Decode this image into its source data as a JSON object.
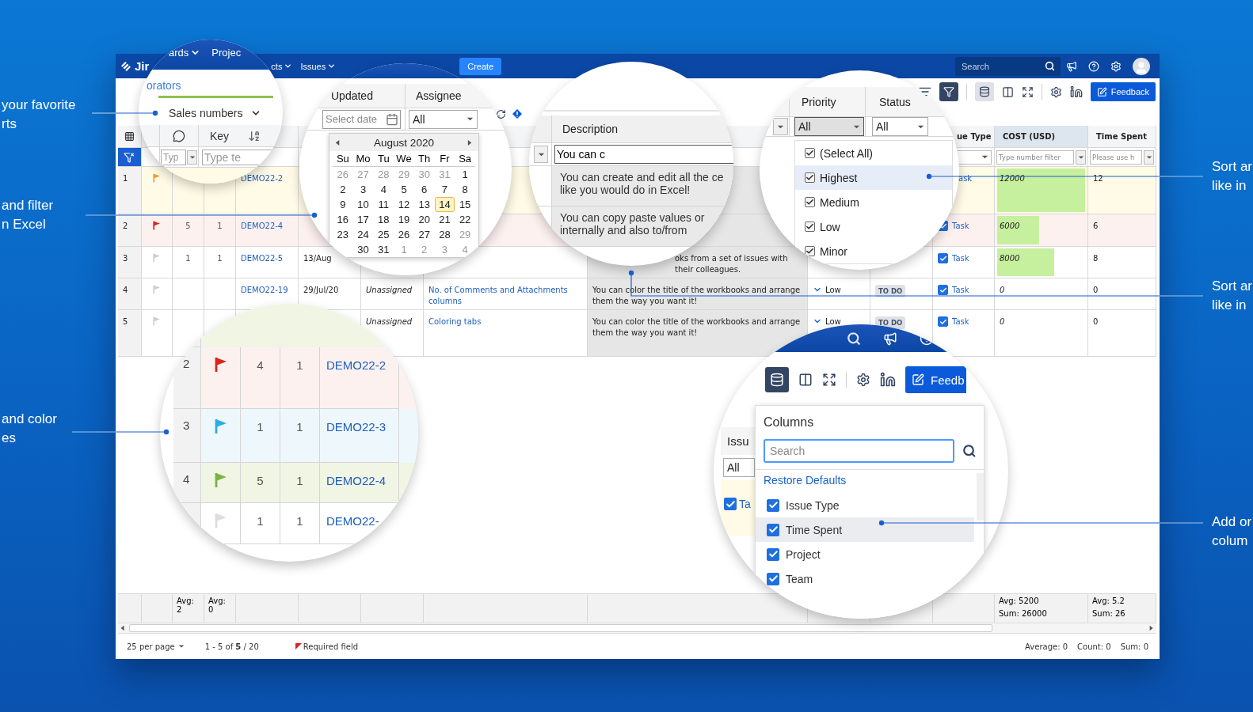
{
  "captions_left": [
    {
      "lines": [
        "your favorite",
        "rts"
      ]
    },
    {
      "lines": [
        "and filter",
        "n Excel"
      ]
    },
    {
      "lines": [
        "and color",
        "es"
      ]
    }
  ],
  "captions_right": [
    {
      "lines": [
        "Sort ar",
        "like in"
      ]
    },
    {
      "lines": [
        "Sort ar",
        "like in"
      ]
    },
    {
      "lines": [
        "Add or",
        "colum"
      ]
    }
  ],
  "navbar": {
    "logo": "Jir",
    "items": [
      "cts",
      "Issues"
    ],
    "create": "Create",
    "search": {
      "placeholder": "Search"
    }
  },
  "toolbar": {
    "filter_on": true,
    "columns_on": true,
    "feedback": "Feedback"
  },
  "header": {
    "issue_type": "ue Type",
    "cost": "COST (USD)",
    "time_spent": "Time Spent"
  },
  "filters": {
    "cost": {
      "placeholder": "Type number filter"
    },
    "time_spent": {
      "placeholder": "Please use h"
    }
  },
  "rows": [
    {
      "number": "1",
      "flag": {
        "color": "#f0a030"
      },
      "color": "#fffbe6",
      "key": "DEMO22-2",
      "issue_type": {
        "label": "ask",
        "cut": true
      },
      "cost": {
        "value": "12000",
        "level": 1
      },
      "time_spent": "12"
    },
    {
      "number": "2",
      "flag": {
        "color": "#d9261c"
      },
      "color": "#fdf1f0",
      "comments": "5",
      "attachments": "1",
      "key": "DEMO22-4",
      "issue_type": {
        "label": "Task",
        "checked": true
      },
      "cost": {
        "value": "6000",
        "level": 0.5
      },
      "time_spent": "6"
    },
    {
      "number": "3",
      "flag": {
        "color": "#cfcfcf"
      },
      "color": "#ffffff",
      "comments": "1",
      "attachments": "1",
      "key": "DEMO22-5",
      "updated": "13/Aug",
      "description": "oks from a set of issues with their colleagues.",
      "description_cut": true,
      "issue_type": {
        "label": "Task",
        "checked": true
      },
      "cost": {
        "value": "8000",
        "level": 0.67
      },
      "time_spent": "8"
    },
    {
      "number": "4",
      "flag": {
        "color": "#cfcfcf"
      },
      "color": "#ffffff",
      "key": "DEMO22-19",
      "updated": "29/Jul/20",
      "assignee": "Unassigned",
      "summary": "No. of Comments and Attachments columns",
      "description": "You can color the title of the workbooks and arrange them the way you want it!",
      "priority": "Low",
      "status": "TO DO",
      "issue_type": {
        "label": "Task",
        "checked": true
      },
      "cost": {
        "value": "0"
      },
      "time_spent": "0"
    },
    {
      "number": "5",
      "flag": {
        "color": "#cfcfcf"
      },
      "color": "#ffffff",
      "assignee": "Unassigned",
      "summary": "Coloring tabs",
      "description": "You can color the title of the workbooks and arrange them the way you want it!",
      "priority": "Low",
      "status": "TO DO",
      "issue_type": {
        "label": "Task",
        "checked": true
      },
      "cost": {
        "value": "0"
      },
      "time_spent": "0"
    }
  ],
  "aggregates": {
    "comments": [
      "Avg: 2"
    ],
    "attachments": [
      "Avg: 0"
    ],
    "cost": [
      "Avg: 5200",
      "Sum: 26000"
    ],
    "time_spent": [
      "Avg: 5.2",
      "Sum: 26"
    ]
  },
  "status_bar": {
    "per_page": "25 per page",
    "range": "1 - 5 of **5** / 20",
    "required": "Required field",
    "stats": [
      "Average: 0",
      "Count: 0",
      "Sum: 0"
    ]
  },
  "lens_tabs": {
    "nav": [
      "ards",
      "Projec"
    ],
    "tab": "orators",
    "workbook": "Sales numbers",
    "key_header": "Key",
    "filters": [
      {
        "placeholder": "Typ"
      },
      {
        "placeholder": "Type te"
      }
    ]
  },
  "lens_date": {
    "headers": [
      "Updated",
      "Assignee"
    ],
    "date_filter": {
      "placeholder": "Select date"
    },
    "assignee_filter": "All",
    "month": "August 2020",
    "weekdays": [
      "Su",
      "Mo",
      "Tu",
      "We",
      "Th",
      "Fr",
      "Sa"
    ],
    "weeks": [
      [
        {
          "d": "26",
          "muted": true,
          "selected": false
        },
        {
          "d": "27",
          "muted": true,
          "selected": false
        },
        {
          "d": "28",
          "muted": true,
          "selected": false
        },
        {
          "d": "29",
          "muted": true,
          "selected": false
        },
        {
          "d": "30",
          "muted": true,
          "selected": false
        },
        {
          "d": "31",
          "muted": true,
          "selected": false
        },
        {
          "d": "1",
          "muted": false,
          "selected": false
        }
      ],
      [
        {
          "d": "2",
          "muted": false,
          "selected": false
        },
        {
          "d": "3",
          "muted": false,
          "selected": false
        },
        {
          "d": "4",
          "muted": false,
          "selected": false
        },
        {
          "d": "5",
          "muted": false,
          "selected": false
        },
        {
          "d": "6",
          "muted": false,
          "selected": false
        },
        {
          "d": "7",
          "muted": false,
          "selected": false
        },
        {
          "d": "8",
          "muted": false,
          "selected": false
        }
      ],
      [
        {
          "d": "9",
          "muted": false,
          "selected": false
        },
        {
          "d": "10",
          "muted": false,
          "selected": false
        },
        {
          "d": "11",
          "muted": false,
          "selected": false
        },
        {
          "d": "12",
          "muted": false,
          "selected": false
        },
        {
          "d": "13",
          "muted": false,
          "selected": false
        },
        {
          "d": "14",
          "muted": false,
          "selected": true
        },
        {
          "d": "15",
          "muted": false,
          "selected": false
        }
      ],
      [
        {
          "d": "16",
          "muted": false,
          "selected": false
        },
        {
          "d": "17",
          "muted": false,
          "selected": false
        },
        {
          "d": "18",
          "muted": false,
          "selected": false
        },
        {
          "d": "19",
          "muted": false,
          "selected": false
        },
        {
          "d": "20",
          "muted": false,
          "selected": false
        },
        {
          "d": "21",
          "muted": false,
          "selected": false
        },
        {
          "d": "22",
          "muted": false,
          "selected": false
        }
      ],
      [
        {
          "d": "23",
          "muted": false,
          "selected": false
        },
        {
          "d": "24",
          "muted": false,
          "selected": false
        },
        {
          "d": "25",
          "muted": false,
          "selected": false
        },
        {
          "d": "26",
          "muted": false,
          "selected": false
        },
        {
          "d": "27",
          "muted": false,
          "selected": false
        },
        {
          "d": "28",
          "muted": false,
          "selected": false
        },
        {
          "d": "29",
          "muted": true,
          "selected": false
        }
      ],
      [
        {
          "d": "30",
          "muted": false,
          "selected": false
        },
        {
          "d": "31",
          "muted": false,
          "selected": false
        },
        {
          "d": "1",
          "muted": true,
          "selected": false
        },
        {
          "d": "2",
          "muted": true,
          "selected": false
        },
        {
          "d": "3",
          "muted": true,
          "selected": false
        },
        {
          "d": "4",
          "muted": true,
          "selected": false
        }
      ]
    ]
  },
  "lens_description": {
    "header": "Description",
    "filter_value": "You can c",
    "cells": [
      [
        "You can create and edit all the ce",
        "like you would do in Excel!"
      ],
      [
        "You can copy paste values or",
        "internally and also to/from"
      ]
    ]
  },
  "lens_priority": {
    "headers": [
      "Priority",
      "Status"
    ],
    "filters": [
      "All",
      "All"
    ],
    "options": [
      {
        "label": "(Select All)",
        "checked": true,
        "selected": false
      },
      {
        "label": "Highest",
        "checked": true,
        "selected": true
      },
      {
        "label": "Medium",
        "checked": true,
        "selected": false
      },
      {
        "label": "Low",
        "checked": true,
        "selected": false
      },
      {
        "label": "Minor",
        "checked": true,
        "selected": false
      }
    ]
  },
  "lens_rows": {
    "rows": [
      {
        "number": "2",
        "flag": {
          "color": "#d9261c"
        },
        "color": "#fdf1f0",
        "comments": "4",
        "attachments": "1",
        "key": "DEMO22-2"
      },
      {
        "number": "3",
        "flag": {
          "color": "#2aaee4"
        },
        "color": "#eef7fc",
        "comments": "1",
        "attachments": "1",
        "key": "DEMO22-3"
      },
      {
        "number": "4",
        "flag": {
          "color": "#7cb342"
        },
        "color": "#f0f5e4",
        "comments": "5",
        "attachments": "1",
        "key": "DEMO22-4"
      },
      {
        "flag": {
          "color": "#dddddd"
        },
        "color": "#ffffff",
        "comments": "1",
        "attachments": "1",
        "key": "DEMO22-"
      }
    ]
  },
  "lens_columns": {
    "feedback": "Feedb",
    "behind": {
      "header": "Issu",
      "filter": "All",
      "cells": [
        {
          "label": "Ta",
          "checked": true
        }
      ]
    },
    "title": "Columns",
    "search": {
      "placeholder": "Search"
    },
    "restore": "Restore Defaults",
    "items": [
      {
        "label": "Issue Type",
        "checked": true,
        "selected": false
      },
      {
        "label": "Time Spent",
        "checked": true,
        "selected": true
      },
      {
        "label": "Project",
        "checked": true,
        "selected": false
      },
      {
        "label": "Team",
        "checked": true,
        "selected": false
      }
    ]
  }
}
